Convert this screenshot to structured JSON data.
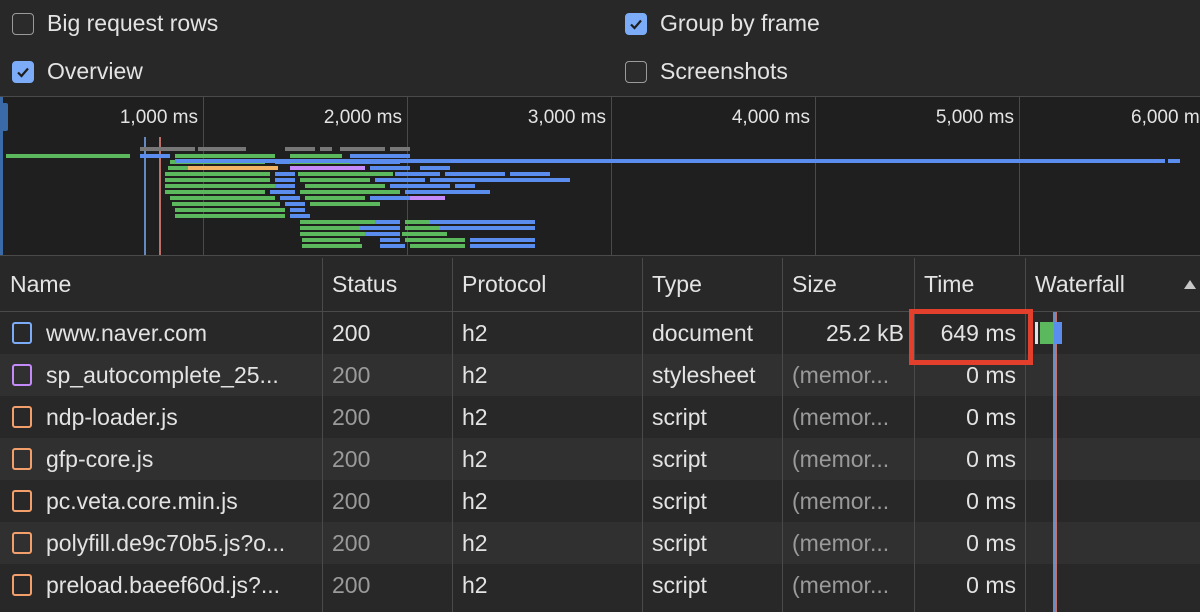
{
  "settings": {
    "big_request_rows": {
      "label": "Big request rows",
      "checked": false
    },
    "group_by_frame": {
      "label": "Group by frame",
      "checked": true
    },
    "overview": {
      "label": "Overview",
      "checked": true
    },
    "screenshots": {
      "label": "Screenshots",
      "checked": false
    }
  },
  "overview": {
    "ticks": [
      "1,000 ms",
      "2,000 ms",
      "3,000 ms",
      "4,000 ms",
      "5,000 ms",
      "6,000 ms"
    ]
  },
  "table": {
    "headers": {
      "name": "Name",
      "status": "Status",
      "protocol": "Protocol",
      "type": "Type",
      "size": "Size",
      "time": "Time",
      "waterfall": "Waterfall"
    },
    "rows": [
      {
        "name": "www.naver.com",
        "icon": "document-icon",
        "status": "200",
        "protocol": "h2",
        "type": "document",
        "size": "25.2 kB",
        "time": "649 ms"
      },
      {
        "name": "sp_autocomplete_25...",
        "icon": "stylesheet-icon",
        "status": "200",
        "protocol": "h2",
        "type": "stylesheet",
        "size": "(memor...",
        "time": "0 ms"
      },
      {
        "name": "ndp-loader.js",
        "icon": "script-icon",
        "status": "200",
        "protocol": "h2",
        "type": "script",
        "size": "(memor...",
        "time": "0 ms"
      },
      {
        "name": "gfp-core.js",
        "icon": "script-icon",
        "status": "200",
        "protocol": "h2",
        "type": "script",
        "size": "(memor...",
        "time": "0 ms"
      },
      {
        "name": "pc.veta.core.min.js",
        "icon": "script-icon",
        "status": "200",
        "protocol": "h2",
        "type": "script",
        "size": "(memor...",
        "time": "0 ms"
      },
      {
        "name": "polyfill.de9c70b5.js?o...",
        "icon": "script-icon",
        "status": "200",
        "protocol": "h2",
        "type": "script",
        "size": "(memor...",
        "time": "0 ms"
      },
      {
        "name": "preload.baeef60d.js?...",
        "icon": "script-icon",
        "status": "200",
        "protocol": "h2",
        "type": "script",
        "size": "(memor...",
        "time": "0 ms"
      }
    ]
  },
  "colors": {
    "accent": "#7cacf8",
    "highlight_box": "#e2402c",
    "waterfall_green": "#5cb85c",
    "waterfall_blue": "#5b8def"
  }
}
